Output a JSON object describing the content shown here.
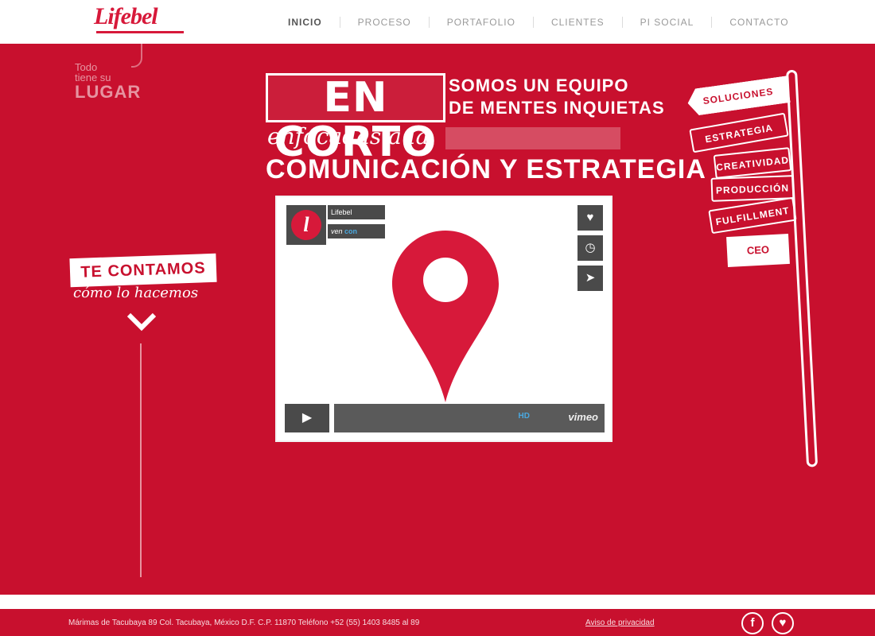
{
  "header": {
    "logo": "Lifebel",
    "nav": [
      "INICIO",
      "PROCESO",
      "PORTAFOLIO",
      "CLIENTES",
      "PI SOCIAL",
      "CONTACTO"
    ]
  },
  "tagline": {
    "line1": "Todo",
    "line2": "tiene su",
    "line3": "LUGAR"
  },
  "headline": {
    "boxed": "EN CORTO",
    "right_line1": "SOMOS UN EQUIPO",
    "right_line2": "DE MENTES INQUIETAS",
    "script": "enfocadas a la",
    "bottom": "COMUNICACIÓN Y ESTRATEGIA"
  },
  "video": {
    "title_line1": "Lifebel",
    "title_line2": "ven",
    "title_highlight": "con",
    "hd": "HD",
    "provider": "vimeo",
    "pin_color": "#d7193a"
  },
  "cta": {
    "label": "TE CONTAMOS",
    "sub": "cómo lo hacemos"
  },
  "signpost": {
    "signs": [
      "SOLUCIONES",
      "ESTRATEGIA",
      "CREATIVIDAD",
      "PRODUCCIÓN",
      "FULFILLMENT"
    ],
    "end": "CEO"
  },
  "footer": {
    "address": "Márimas de Tacubaya 89 Col. Tacubaya, México D.F. C.P. 11870 Teléfono +52 (55) 1403 8485 al 89",
    "privacy": "Aviso de privacidad",
    "social": [
      "f",
      "♥"
    ]
  },
  "colors": {
    "brand_red": "#c8102e",
    "accent_red": "#d7193a",
    "dark": "#4a4a4a"
  }
}
